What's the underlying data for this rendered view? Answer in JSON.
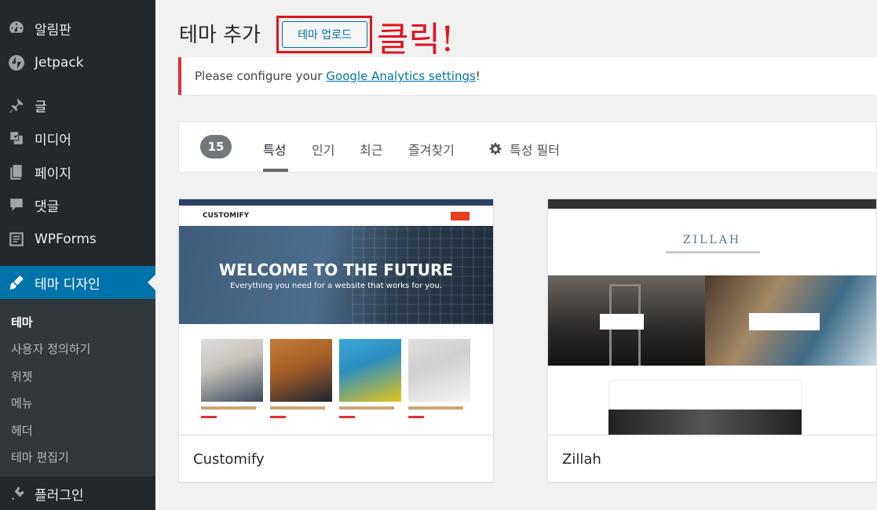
{
  "sidebar": {
    "items": [
      {
        "label": "알림판",
        "icon": "dashboard-icon"
      },
      {
        "label": "Jetpack",
        "icon": "jetpack-icon"
      },
      {
        "label": "글",
        "icon": "pin-icon"
      },
      {
        "label": "미디어",
        "icon": "media-icon"
      },
      {
        "label": "페이지",
        "icon": "pages-icon"
      },
      {
        "label": "댓글",
        "icon": "comments-icon"
      },
      {
        "label": "WPForms",
        "icon": "wpforms-icon"
      },
      {
        "label": "테마 디자인",
        "icon": "appearance-brush-icon",
        "active": true
      },
      {
        "label": "플러그인",
        "icon": "plugins-icon"
      }
    ],
    "submenu": [
      "테마",
      "사용자 정의하기",
      "위젯",
      "메뉴",
      "헤더",
      "테마 편집기"
    ]
  },
  "header": {
    "title": "테마 추가",
    "upload_button": "테마 업로드",
    "annotation": "클릭!"
  },
  "notice": {
    "prefix": "Please configure your",
    "link": "Google Analytics settings",
    "suffix": "!"
  },
  "filter": {
    "count": "15",
    "tabs": [
      "특성",
      "인기",
      "최근",
      "즐겨찾기"
    ],
    "current_tab": "특성",
    "feature_filter": "특성 필터"
  },
  "themes": [
    {
      "name": "Customify",
      "preview": {
        "logo": "CUSTOMIFY",
        "hero_title": "WELCOME TO THE FUTURE",
        "hero_subtitle": "Everything you need for a website that works for you."
      }
    },
    {
      "name": "Zillah",
      "preview": {
        "logo": "ZILLAH"
      }
    }
  ],
  "colors": {
    "sidebar_bg": "#23282d",
    "active_blue": "#0073aa",
    "annotation_red": "#e0141e",
    "notice_border": "#dc3232"
  }
}
